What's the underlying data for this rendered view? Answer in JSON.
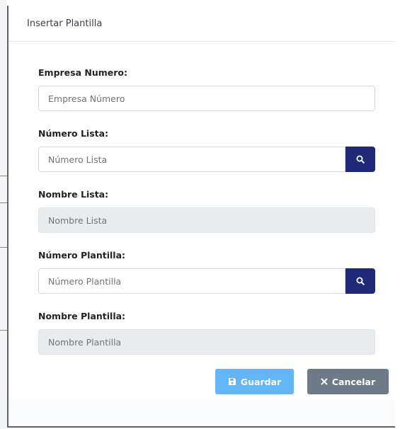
{
  "modal": {
    "title": "Insertar Plantilla"
  },
  "form": {
    "empresa_numero": {
      "label": "Empresa Numero:",
      "placeholder": "Empresa Número"
    },
    "numero_lista": {
      "label": "Número Lista:",
      "placeholder": "Número Lista"
    },
    "nombre_lista": {
      "label": "Nombre Lista:",
      "placeholder": "Nombre Lista"
    },
    "numero_plantilla": {
      "label": "Número Plantilla:",
      "placeholder": "Número Plantilla"
    },
    "nombre_plantilla": {
      "label": "Nombre Plantilla:",
      "placeholder": "Nombre Plantilla"
    }
  },
  "actions": {
    "save_label": "Guardar",
    "cancel_label": "Cancelar"
  },
  "icons": {
    "search": "search-icon",
    "save": "floppy-disk-icon",
    "cancel": "times-icon"
  },
  "colors": {
    "search_button": "#1e2a78",
    "save_button": "#62b6f6",
    "cancel_button": "#6e7b86",
    "disabled_input": "#e9ecef"
  }
}
